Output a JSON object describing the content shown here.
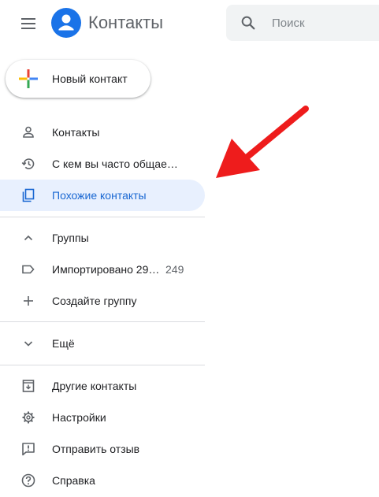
{
  "header": {
    "app_title": "Контакты",
    "search_placeholder": "Поиск"
  },
  "new_contact_label": "Новый контакт",
  "nav": {
    "contacts": "Контакты",
    "frequent": "С кем вы часто общае…",
    "similar": "Похожие контакты"
  },
  "groups": {
    "header": "Группы",
    "imported_label": "Импортировано 29…",
    "imported_count": "249",
    "create": "Создайте группу"
  },
  "more": "Ещё",
  "footer": {
    "other_contacts": "Другие контакты",
    "settings": "Настройки",
    "feedback": "Отправить отзыв",
    "help": "Справка"
  },
  "colors": {
    "accent": "#1967d2",
    "active_bg": "#e8f0fe",
    "arrow": "#ee1c1c",
    "logo": "#1a73e8"
  }
}
